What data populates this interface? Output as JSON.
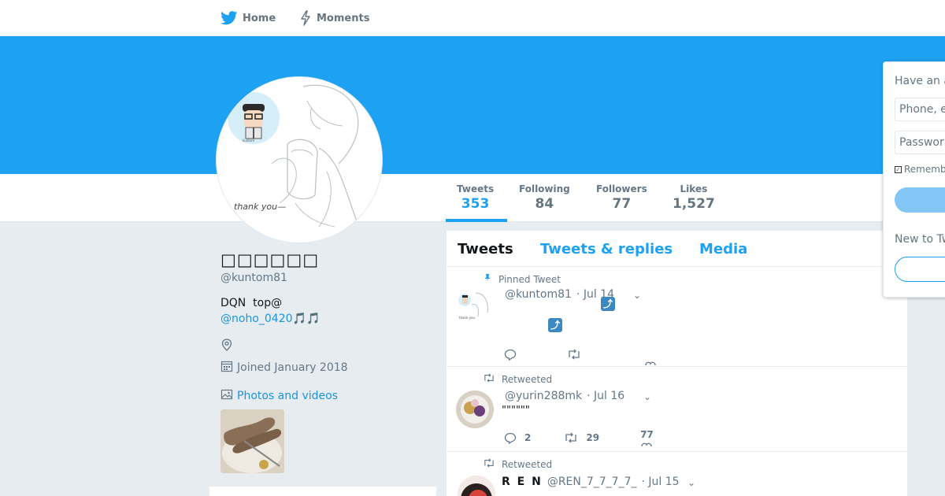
{
  "nav": {
    "home_label": "Home",
    "moments_label": "Moments"
  },
  "profile": {
    "name": "□□□□□□",
    "handle": "@kuntom81",
    "bio_line1": "DQN  top@",
    "bio_link": "@noho_0420🎵🎵",
    "joined": "Joined January 2018",
    "photos_label": "Photos and videos",
    "avatar_text": "thank you—"
  },
  "stats": [
    {
      "label": "Tweets",
      "value": "353"
    },
    {
      "label": "Following",
      "value": "84"
    },
    {
      "label": "Followers",
      "value": "77"
    },
    {
      "label": "Likes",
      "value": "1,527"
    }
  ],
  "tabs": {
    "tweets": "Tweets",
    "replies": "Tweets & replies",
    "media": "Media"
  },
  "tweets": [
    {
      "context": "Pinned Tweet",
      "handle": "@kuntom81",
      "date": "· Jul 14",
      "emoji": "⤴",
      "replies": "",
      "retweets": "",
      "likes": ""
    },
    {
      "context": "Retweeted",
      "handle": "@yurin288mk",
      "date": "· Jul 16",
      "text": "\"\"\"\"\"\"",
      "replies": "2",
      "retweets": "29",
      "likes": "77"
    },
    {
      "context": "Retweeted",
      "fullname": "R E N",
      "handle": "@REN_7_7_7_7_",
      "date": "· Jul 15"
    }
  ],
  "login": {
    "title": "Have an a",
    "phone_placeholder": "Phone, e",
    "password_placeholder": "Passwor",
    "remember": "Rememb",
    "new_to": "New to Tw"
  },
  "colors": {
    "brand": "#1da1f2",
    "link": "#1b95e0",
    "background": "#e6ecf0"
  }
}
